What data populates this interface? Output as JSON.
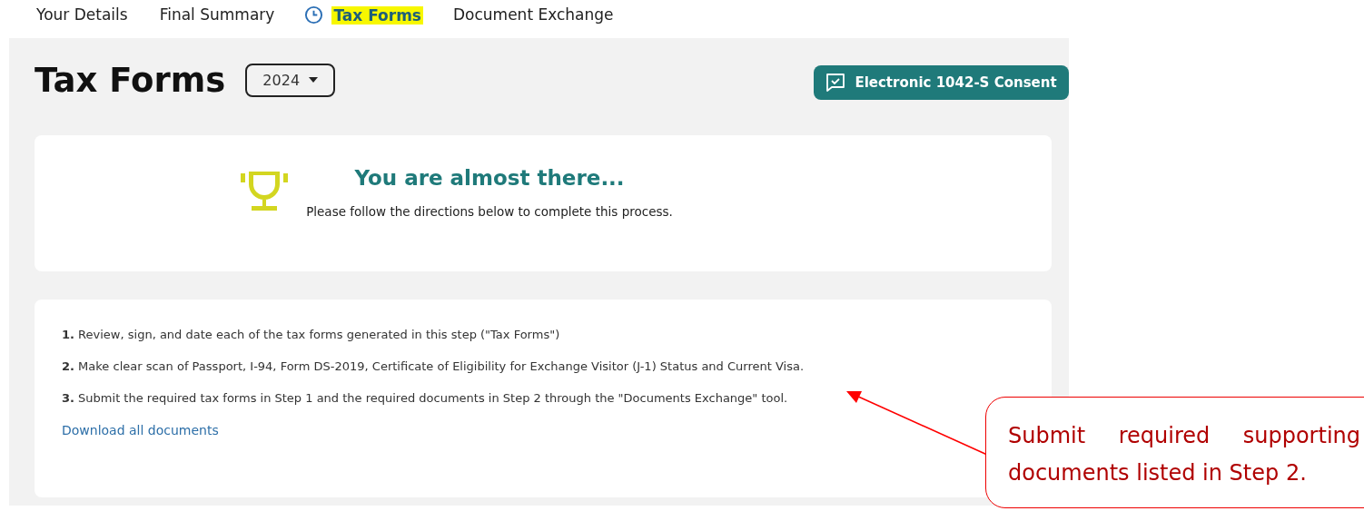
{
  "tabs": [
    {
      "label": "Your Details",
      "selected": false
    },
    {
      "label": "Final Summary",
      "selected": false
    },
    {
      "label": "Tax Forms",
      "selected": true
    },
    {
      "label": "Document Exchange",
      "selected": false
    }
  ],
  "page": {
    "title": "Tax Forms",
    "year_select": {
      "value": "2024"
    },
    "consent_button": "Electronic 1042-S Consent"
  },
  "banner": {
    "heading": "You are almost there...",
    "text": "Please follow the directions below to complete this process."
  },
  "steps": [
    "**1.** Review, sign, and date each of the tax forms generated in this step (\"Tax Forms\")",
    "**2.** Make clear scan of Passport, I-94, Form DS-2019, Certificate of Eligibility for Exchange Visitor (J-1) Status and Current Visa.",
    "**3.** Submit the required tax forms in Step 1 and the required documents in Step 2 through the \"Documents Exchange\" tool."
  ],
  "download_link": "Download all documents",
  "callout": {
    "text": "Submit required supporting documents listed in Step 2."
  }
}
